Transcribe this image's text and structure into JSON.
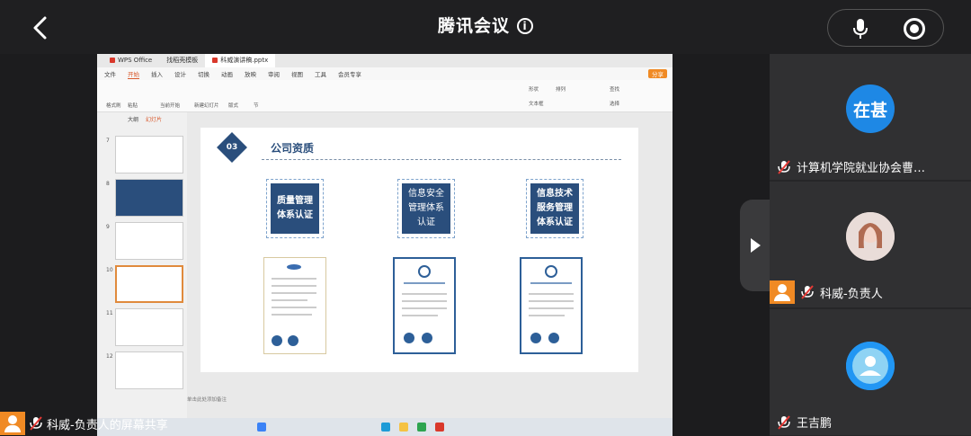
{
  "header": {
    "title": "腾讯会议",
    "info_glyph": "i"
  },
  "wps": {
    "tabs": [
      "WPS Office",
      "找稻壳模板",
      "科威演讲稿.pptx"
    ],
    "menu": [
      "文件",
      "开始",
      "插入",
      "设计",
      "切换",
      "动画",
      "放映",
      "审阅",
      "视图",
      "工具",
      "会员专享"
    ],
    "active_menu": "开始",
    "share_label": "分享",
    "ribbon_labels": [
      "格式刷",
      "粘贴",
      "当前开始",
      "新建幻灯片",
      "版式",
      "节",
      "形状",
      "排列",
      "查找",
      "选择",
      "文本框"
    ],
    "panel_tabs": [
      "大纲",
      "幻灯片"
    ],
    "thumb_numbers": [
      "7",
      "8",
      "9",
      "10",
      "11",
      "12"
    ],
    "notes_placeholder": "单击此处添加备注",
    "slide": {
      "section_number": "03",
      "title": "公司资质",
      "certs": [
        "质量管理\n体系认证",
        "信息安全\n管理体系\n认证",
        "信息技术\n服务管理\n体系认证"
      ]
    }
  },
  "participants": [
    {
      "avatar_text": "在甚",
      "name": "计算机学院就业协会曹…",
      "avatar_color": "#1e88e5"
    },
    {
      "avatar_text": "",
      "name": "科威-负责人",
      "avatar_color": "#e9dcd8"
    },
    {
      "avatar_text": "",
      "name": "王吉鹏",
      "avatar_color": "#2196f3"
    }
  ],
  "sharer_label": "科威-负责人的屏幕共享",
  "colors": {
    "accent_orange": "#f08a24",
    "slide_blue": "#2a4e7c"
  }
}
